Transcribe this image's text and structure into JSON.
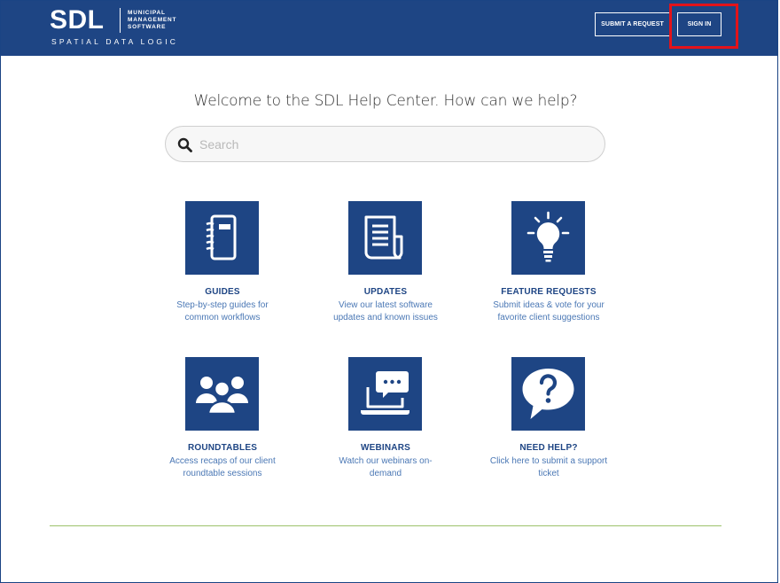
{
  "header": {
    "logo_main": "SDL",
    "logo_side": [
      "MUNICIPAL",
      "MANAGEMENT",
      "SOFTWARE"
    ],
    "logo_sub": "SPATIAL DATA LOGIC",
    "submit_request_label": "SUBMIT A REQUEST",
    "sign_in_label": "SIGN IN"
  },
  "hero": {
    "welcome": "Welcome to the SDL Help Center. How can we help?"
  },
  "search": {
    "placeholder": "Search",
    "value": ""
  },
  "cards": [
    {
      "title": "GUIDES",
      "desc": [
        "Step-by-step guides for",
        "common workflows"
      ],
      "icon": "notebook-icon"
    },
    {
      "title": "UPDATES",
      "desc": [
        "View our latest software",
        "updates and known issues"
      ],
      "icon": "newspaper-icon"
    },
    {
      "title": "FEATURE REQUESTS",
      "desc": [
        "Submit ideas & vote for your",
        "favorite client suggestions"
      ],
      "icon": "lightbulb-icon"
    },
    {
      "title": "ROUNDTABLES",
      "desc": [
        "Access recaps of our client",
        "roundtable sessions"
      ],
      "icon": "group-icon"
    },
    {
      "title": "WEBINARS",
      "desc": [
        "Watch our webinars on-",
        "demand"
      ],
      "icon": "laptop-chat-icon"
    },
    {
      "title": "NEED HELP?",
      "desc": [
        "Click here to submit a support",
        "ticket"
      ],
      "icon": "question-bubble-icon"
    }
  ],
  "colors": {
    "brand": "#1e4584",
    "link": "#4b78b5",
    "highlight": "#e3131a",
    "divider": "#9cc26b"
  }
}
